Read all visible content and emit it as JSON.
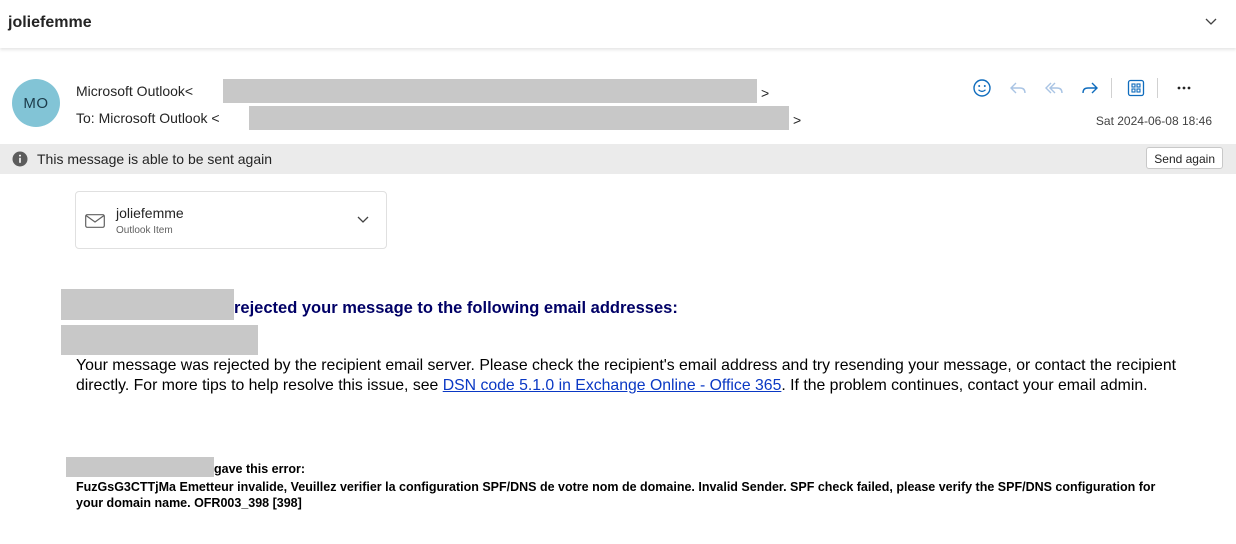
{
  "header": {
    "subject": "joliefemme",
    "collapse_icon": "chevron-down-icon"
  },
  "message": {
    "avatar_initials": "MO",
    "from_name": "Microsoft Outlook<",
    "from_close": ">",
    "to_label": "To:",
    "to_name": "Microsoft Outlook <",
    "to_close": ">",
    "date": "Sat 2024-06-08 18:46",
    "actions": [
      {
        "icon": "emoji-icon",
        "label": "React"
      },
      {
        "icon": "reply-icon",
        "label": "Reply"
      },
      {
        "icon": "reply-all-icon",
        "label": "Reply all"
      },
      {
        "icon": "forward-icon",
        "label": "Forward"
      },
      {
        "icon": "apps-icon",
        "label": "Apps"
      },
      {
        "icon": "more-icon",
        "label": "More actions"
      }
    ]
  },
  "infobar": {
    "text": "This message is able to be sent again",
    "button": "Send again",
    "icon": "info-icon"
  },
  "attachment": {
    "name": "joliefemme",
    "type": "Outlook Item",
    "icon": "mail-icon",
    "chevron": "chevron-down-icon"
  },
  "body": {
    "headline": "rejected your message to the following email addresses:",
    "para_part1": "Your message was rejected by the recipient email server. Please check the recipient's email address and try resending your message, or contact the recipient directly. For more tips to help resolve this issue, see ",
    "link_text": "DSN code 5.1.0 in Exchange Online - Office 365",
    "para_part2": ". If the problem continues, contact your email admin.",
    "error_title": "gave this error:",
    "error_text": "FuzGsG3CTTjMa Emetteur invalide, Veuillez verifier la configuration SPF/DNS de votre nom de domaine. Invalid Sender. SPF check failed, please verify the SPF/DNS configuration for your domain name. OFR003_398 [398]"
  },
  "colors": {
    "avatar_bg": "#82c4d6",
    "accent": "#0f6cbd",
    "headline": "#000066",
    "link": "#0a38c4"
  }
}
